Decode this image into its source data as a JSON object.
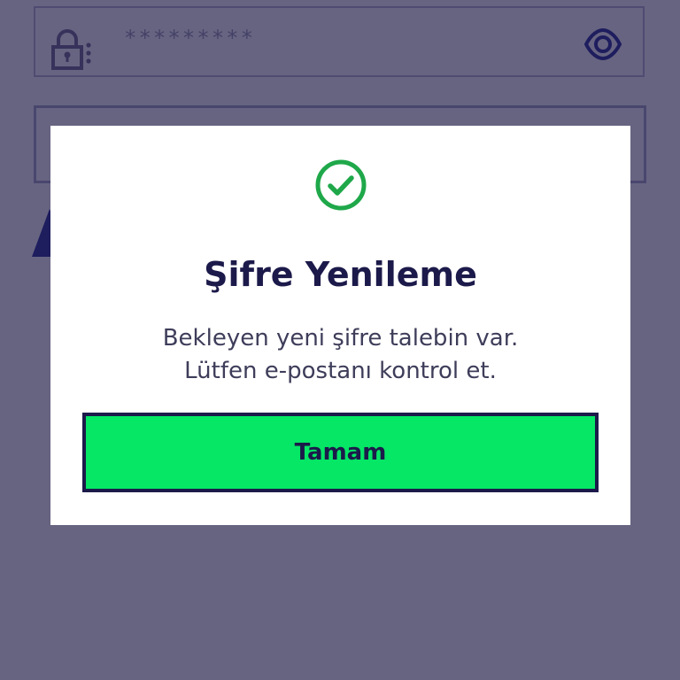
{
  "password_field": {
    "value": "*********",
    "lock_icon": "lock-icon",
    "toggle_icon": "eye-icon"
  },
  "dialog": {
    "status_icon": "check-circle-icon",
    "title": "Şifre Yenileme",
    "message_line1": "Bekleyen yeni şifre talebin var.",
    "message_line2": "Lütfen e-postanı kontrol et.",
    "ok_label": "Tamam"
  },
  "colors": {
    "overlay": "#181440",
    "brand_navy": "#1c1a4a",
    "accent_green": "#05e765",
    "success_green": "#1fa84a",
    "icon_blue": "#2a2f9a"
  }
}
